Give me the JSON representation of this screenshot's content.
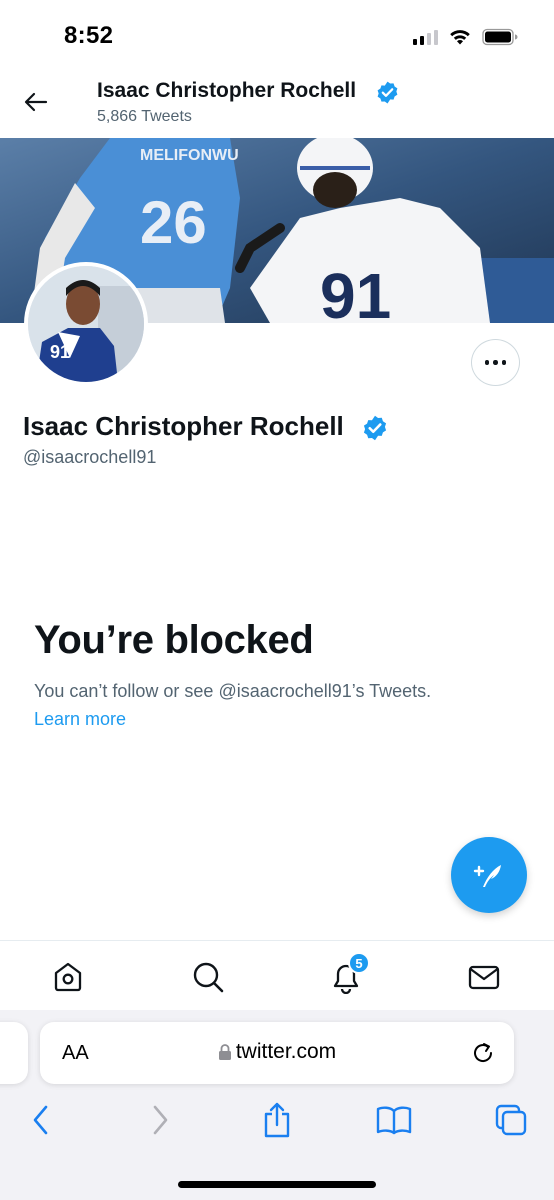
{
  "status_bar": {
    "time": "8:52"
  },
  "header": {
    "title": "Isaac Christopher Rochell",
    "subtitle": "5,866 Tweets"
  },
  "profile": {
    "name": "Isaac Christopher Rochell",
    "handle": "@isaacrochell91"
  },
  "banner": {
    "jersey_left": "26",
    "jersey_right": "91",
    "name_plate": "MELIFONWU"
  },
  "blocked": {
    "title": "You’re blocked",
    "description": "You can’t follow or see @isaacrochell91’s Tweets.",
    "link": "Learn more"
  },
  "bottom_nav": {
    "items": [
      "home-icon",
      "search-icon",
      "bell-icon",
      "mail-icon"
    ],
    "notification_count": "5"
  },
  "safari": {
    "aa_label": "AA",
    "url": "twitter.com"
  },
  "colors": {
    "accent": "#1d9bf0",
    "text": "#0f1419",
    "secondary": "#536471"
  }
}
